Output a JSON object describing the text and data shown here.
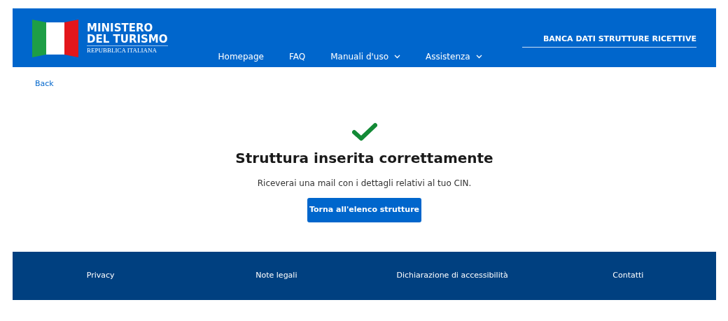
{
  "header": {
    "logo": {
      "line_1": "MINISTERO",
      "line_2": "DEL TURISMO",
      "line_3": "REPUBBLICA ITALIANA"
    },
    "nav": [
      {
        "label": "Homepage",
        "has_menu": false
      },
      {
        "label": "FAQ",
        "has_menu": false
      },
      {
        "label": "Manuali d'uso",
        "has_menu": true
      },
      {
        "label": "Assistenza",
        "has_menu": true
      }
    ],
    "service_link": "BANCA DATI STRUTTURE RICETTIVE"
  },
  "back_link": "Back",
  "result": {
    "kind": "success",
    "title": "Struttura inserita correttamente",
    "message": "Riceverai una mail con i dettagli relativi al tuo CIN.",
    "button": "Torna all'elenco strutture"
  },
  "footer": {
    "links": [
      "Privacy",
      "Note legali",
      "Dichiarazione di accessibilità",
      "Contatti"
    ]
  }
}
